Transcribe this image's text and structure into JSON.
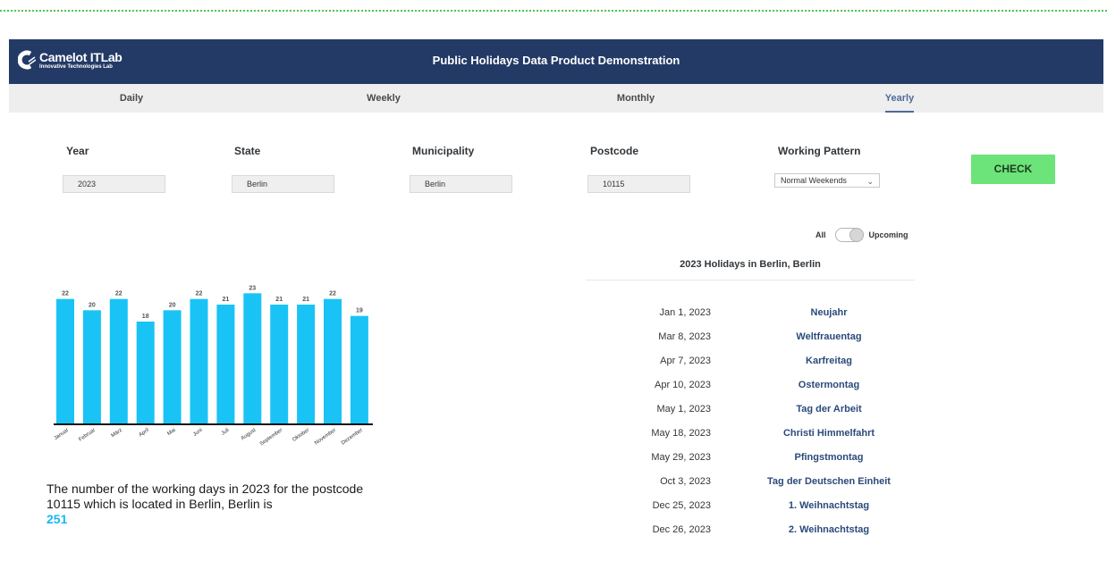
{
  "header": {
    "logo_name": "Camelot ITLab",
    "logo_sub": "Innovative Technologies Lab",
    "title": "Public Holidays Data Product Demonstration"
  },
  "tabs": [
    {
      "label": "Daily",
      "active": false
    },
    {
      "label": "Weekly",
      "active": false
    },
    {
      "label": "Monthly",
      "active": false
    },
    {
      "label": "Yearly",
      "active": true
    }
  ],
  "form": {
    "year": {
      "label": "Year",
      "value": "2023"
    },
    "state": {
      "label": "State",
      "value": "Berlin"
    },
    "municipality": {
      "label": "Municipality",
      "value": "Berlin"
    },
    "postcode": {
      "label": "Postcode",
      "value": "10115"
    },
    "working_pattern": {
      "label": "Working Pattern",
      "value": "Normal Weekends"
    },
    "check_label": "CHECK"
  },
  "toggle": {
    "left_label": "All",
    "right_label": "Upcoming",
    "state": "upcoming"
  },
  "holidays": {
    "title": "2023 Holidays in Berlin, Berlin",
    "items": [
      {
        "date": "Jan 1, 2023",
        "name": "Neujahr"
      },
      {
        "date": "Mar 8, 2023",
        "name": "Weltfrauentag"
      },
      {
        "date": "Apr 7, 2023",
        "name": "Karfreitag"
      },
      {
        "date": "Apr 10, 2023",
        "name": "Ostermontag"
      },
      {
        "date": "May 1, 2023",
        "name": "Tag der Arbeit"
      },
      {
        "date": "May 18, 2023",
        "name": "Christi Himmelfahrt"
      },
      {
        "date": "May 29, 2023",
        "name": "Pfingstmontag"
      },
      {
        "date": "Oct 3, 2023",
        "name": "Tag der Deutschen Einheit"
      },
      {
        "date": "Dec 25, 2023",
        "name": "1. Weihnachtstag"
      },
      {
        "date": "Dec 26, 2023",
        "name": "2. Weihnachtstag"
      }
    ]
  },
  "chart_data": {
    "type": "bar",
    "categories": [
      "Januar",
      "Februar",
      "März",
      "April",
      "Mai",
      "Juni",
      "Juli",
      "August",
      "September",
      "Oktober",
      "November",
      "Dezember"
    ],
    "values": [
      22,
      20,
      22,
      18,
      20,
      22,
      21,
      23,
      21,
      21,
      22,
      19
    ],
    "title": "",
    "xlabel": "",
    "ylabel": "",
    "ylim": [
      0,
      25
    ],
    "bar_color": "#19c3f5",
    "grid": false,
    "legend": "none"
  },
  "summary": {
    "text": "The number of the working days in 2023 for the postcode 10115 which is located in Berlin, Berlin is",
    "count": "251"
  },
  "colors": {
    "header_bg": "#233a66",
    "tab_bar_bg": "#eeeeee",
    "active_tab": "#4e6b9a",
    "check_button": "#6ce47a",
    "accent_blue": "#19c3f5",
    "holiday_name": "#2b4a7a"
  }
}
